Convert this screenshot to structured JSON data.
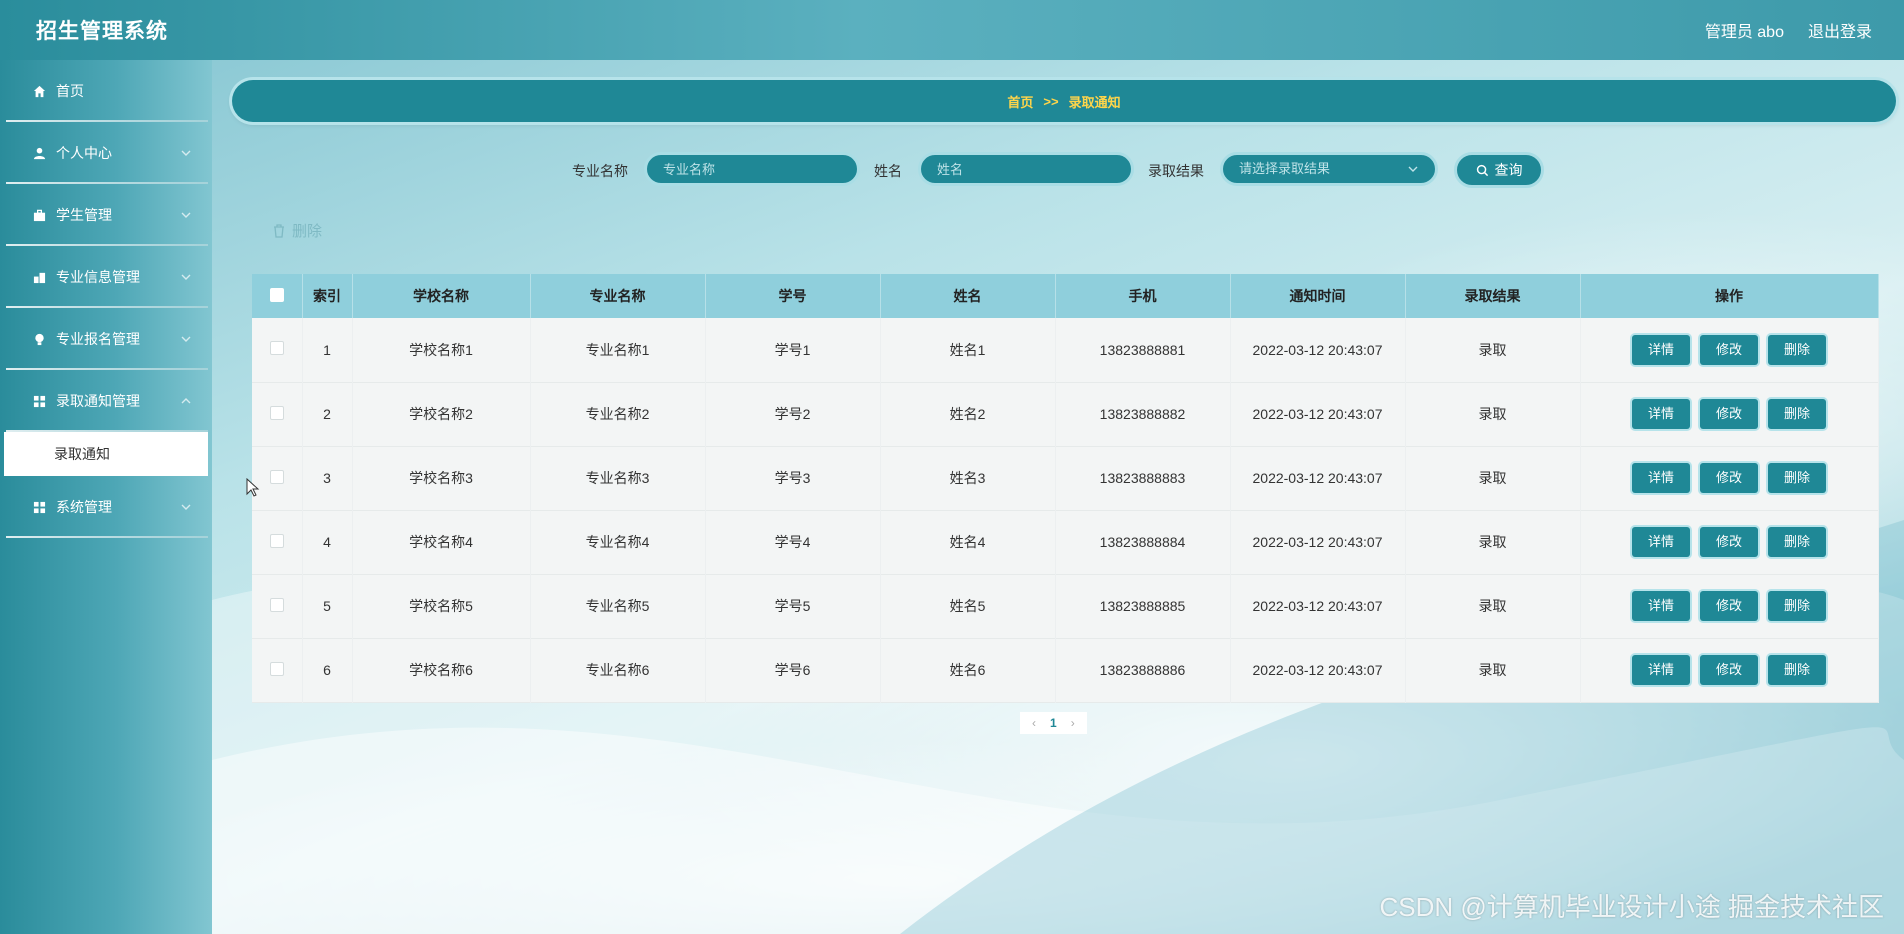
{
  "header": {
    "title": "招生管理系统",
    "user": "管理员 abo",
    "logout": "退出登录"
  },
  "sidebar": {
    "items": [
      {
        "label": "首页",
        "icon": "home-icon",
        "expandable": false
      },
      {
        "label": "个人中心",
        "icon": "user-icon",
        "expandable": true
      },
      {
        "label": "学生管理",
        "icon": "briefcase-icon",
        "expandable": true
      },
      {
        "label": "专业信息管理",
        "icon": "building-icon",
        "expandable": true
      },
      {
        "label": "专业报名管理",
        "icon": "bulb-icon",
        "expandable": true
      },
      {
        "label": "录取通知管理",
        "icon": "grid-icon",
        "expandable": true
      },
      {
        "label": "系统管理",
        "icon": "grid-icon",
        "expandable": true
      }
    ],
    "active_sub": "录取通知"
  },
  "breadcrumb": {
    "home": "首页",
    "separator": ">>",
    "current": "录取通知"
  },
  "search": {
    "major_label": "专业名称",
    "major_placeholder": "专业名称",
    "name_label": "姓名",
    "name_placeholder": "姓名",
    "result_label": "录取结果",
    "result_placeholder": "请选择录取结果",
    "query_button": "查询"
  },
  "actions": {
    "delete_label": "删除"
  },
  "table": {
    "columns": [
      "索引",
      "学校名称",
      "专业名称",
      "学号",
      "姓名",
      "手机",
      "通知时间",
      "录取结果",
      "操作"
    ],
    "rows": [
      {
        "index": "1",
        "school": "学校名称1",
        "major": "专业名称1",
        "student_no": "学号1",
        "name": "姓名1",
        "phone": "13823888881",
        "time": "2022-03-12 20:43:07",
        "result": "录取"
      },
      {
        "index": "2",
        "school": "学校名称2",
        "major": "专业名称2",
        "student_no": "学号2",
        "name": "姓名2",
        "phone": "13823888882",
        "time": "2022-03-12 20:43:07",
        "result": "录取"
      },
      {
        "index": "3",
        "school": "学校名称3",
        "major": "专业名称3",
        "student_no": "学号3",
        "name": "姓名3",
        "phone": "13823888883",
        "time": "2022-03-12 20:43:07",
        "result": "录取"
      },
      {
        "index": "4",
        "school": "学校名称4",
        "major": "专业名称4",
        "student_no": "学号4",
        "name": "姓名4",
        "phone": "13823888884",
        "time": "2022-03-12 20:43:07",
        "result": "录取"
      },
      {
        "index": "5",
        "school": "学校名称5",
        "major": "专业名称5",
        "student_no": "学号5",
        "name": "姓名5",
        "phone": "13823888885",
        "time": "2022-03-12 20:43:07",
        "result": "录取"
      },
      {
        "index": "6",
        "school": "学校名称6",
        "major": "专业名称6",
        "student_no": "学号6",
        "name": "姓名6",
        "phone": "13823888886",
        "time": "2022-03-12 20:43:07",
        "result": "录取"
      }
    ],
    "row_actions": {
      "detail": "详情",
      "edit": "修改",
      "delete": "删除"
    }
  },
  "pagination": {
    "prev": "‹",
    "current": "1",
    "next": "›"
  },
  "watermark": "CSDN @计算机毕业设计小途 掘金技术社区",
  "colors": {
    "accent": "#1f8896",
    "header_bg": "#2a8d9c",
    "table_header": "#8fcfdc",
    "breadcrumb_text": "#ffd54a"
  }
}
